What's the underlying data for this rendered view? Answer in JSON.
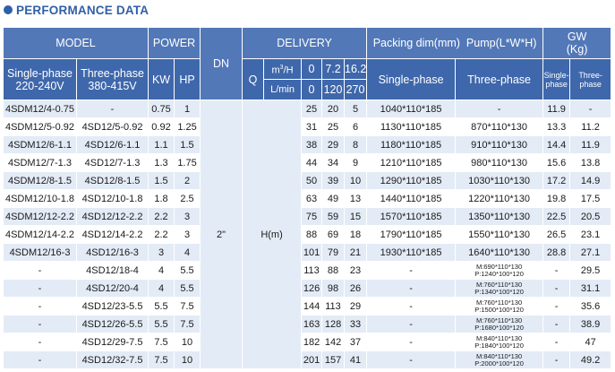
{
  "heading": "PERFORMANCE DATA",
  "header": {
    "model": "MODEL",
    "power": "POWER",
    "dn": "DN",
    "delivery": "DELIVERY",
    "packing": "Packing dim(mm)",
    "pump": "Pump(L*W*H)",
    "gw": "GW\n(Kg)",
    "single_phase": "Single-phase\n220-240V",
    "three_phase": "Three-phase\n380-415V",
    "kw": "KW",
    "hp": "HP",
    "q": "Q",
    "m3h": "m³/H",
    "lmin": "L/min",
    "flow_m3h": [
      "0",
      "7.2",
      "16.2"
    ],
    "flow_lmin": [
      "0",
      "120",
      "270"
    ],
    "pack_single": "Single-phase",
    "pack_three": "Three-phase",
    "gw_single": "Single-\nphase",
    "gw_three": "Three-\nphase"
  },
  "dn_value": "2\"",
  "h_value": "H(m)",
  "rows": [
    {
      "sp": "4SDM12/4-0.75",
      "tp": "-",
      "kw": "0.75",
      "hp": "1",
      "h0": "25",
      "h1": "20",
      "h2": "5",
      "pk1": "1040*110*185",
      "pk3": "-",
      "gw1": "11.9",
      "gw3": "-"
    },
    {
      "sp": "4SDM12/5-0.92",
      "tp": "4SD12/5-0.92",
      "kw": "0.92",
      "hp": "1.25",
      "h0": "31",
      "h1": "25",
      "h2": "6",
      "pk1": "1130*110*185",
      "pk3": "870*110*130",
      "gw1": "13.3",
      "gw3": "11.2"
    },
    {
      "sp": "4SDM12/6-1.1",
      "tp": "4SD12/6-1.1",
      "kw": "1.1",
      "hp": "1.5",
      "h0": "38",
      "h1": "29",
      "h2": "8",
      "pk1": "1180*110*185",
      "pk3": "910*110*130",
      "gw1": "14.4",
      "gw3": "11.9"
    },
    {
      "sp": "4SDM12/7-1.3",
      "tp": "4SD12/7-1.3",
      "kw": "1.3",
      "hp": "1.75",
      "h0": "44",
      "h1": "34",
      "h2": "9",
      "pk1": "1210*110*185",
      "pk3": "980*110*130",
      "gw1": "15.6",
      "gw3": "13.8"
    },
    {
      "sp": "4SDM12/8-1.5",
      "tp": "4SD12/8-1.5",
      "kw": "1.5",
      "hp": "2",
      "h0": "50",
      "h1": "39",
      "h2": "10",
      "pk1": "1290*110*185",
      "pk3": "1030*110*130",
      "gw1": "17.2",
      "gw3": "14.9"
    },
    {
      "sp": "4SDM12/10-1.8",
      "tp": "4SD12/10-1.8",
      "kw": "1.8",
      "hp": "2.5",
      "h0": "63",
      "h1": "49",
      "h2": "13",
      "pk1": "1440*110*185",
      "pk3": "1220*110*130",
      "gw1": "19.8",
      "gw3": "17.5"
    },
    {
      "sp": "4SDM12/12-2.2",
      "tp": "4SD12/12-2.2",
      "kw": "2.2",
      "hp": "3",
      "h0": "75",
      "h1": "59",
      "h2": "15",
      "pk1": "1570*110*185",
      "pk3": "1350*110*130",
      "gw1": "22.5",
      "gw3": "20.5"
    },
    {
      "sp": "4SDM12/14-2.2",
      "tp": "4SD12/14-2.2",
      "kw": "2.2",
      "hp": "3",
      "h0": "88",
      "h1": "69",
      "h2": "18",
      "pk1": "1790*110*185",
      "pk3": "1550*110*130",
      "gw1": "26.5",
      "gw3": "23.1"
    },
    {
      "sp": "4SDM12/16-3",
      "tp": "4SD12/16-3",
      "kw": "3",
      "hp": "4",
      "h0": "101",
      "h1": "79",
      "h2": "21",
      "pk1": "1930*110*185",
      "pk3": "1640*110*130",
      "gw1": "28.8",
      "gw3": "27.1"
    },
    {
      "sp": "-",
      "tp": "4SD12/18-4",
      "kw": "4",
      "hp": "5.5",
      "h0": "113",
      "h1": "88",
      "h2": "23",
      "pk1": "-",
      "pk3a": "M:690*110*130",
      "pk3b": "P:1240*100*120",
      "gw1": "-",
      "gw3": "29.5"
    },
    {
      "sp": "-",
      "tp": "4SD12/20-4",
      "kw": "4",
      "hp": "5.5",
      "h0": "126",
      "h1": "98",
      "h2": "26",
      "pk1": "-",
      "pk3a": "M:760*110*130",
      "pk3b": "P:1340*100*120",
      "gw1": "-",
      "gw3": "31.1"
    },
    {
      "sp": "-",
      "tp": "4SD12/23-5.5",
      "kw": "5.5",
      "hp": "7.5",
      "h0": "144",
      "h1": "113",
      "h2": "29",
      "pk1": "-",
      "pk3a": "M:760*110*130",
      "pk3b": "P:1500*100*120",
      "gw1": "-",
      "gw3": "35.6"
    },
    {
      "sp": "-",
      "tp": "4SD12/26-5.5",
      "kw": "5.5",
      "hp": "7.5",
      "h0": "163",
      "h1": "128",
      "h2": "33",
      "pk1": "-",
      "pk3a": "M:760*110*130",
      "pk3b": "P:1680*100*120",
      "gw1": "-",
      "gw3": "38.9"
    },
    {
      "sp": "-",
      "tp": "4SD12/29-7.5",
      "kw": "7.5",
      "hp": "10",
      "h0": "182",
      "h1": "142",
      "h2": "37",
      "pk1": "-",
      "pk3a": "M:840*110*130",
      "pk3b": "P:1840*100*120",
      "gw1": "-",
      "gw3": "47"
    },
    {
      "sp": "-",
      "tp": "4SD12/32-7.5",
      "kw": "7.5",
      "hp": "10",
      "h0": "201",
      "h1": "157",
      "h2": "41",
      "pk1": "-",
      "pk3a": "M:840*110*130",
      "pk3b": "P:2000*100*120",
      "gw1": "-",
      "gw3": "49.2"
    }
  ]
}
